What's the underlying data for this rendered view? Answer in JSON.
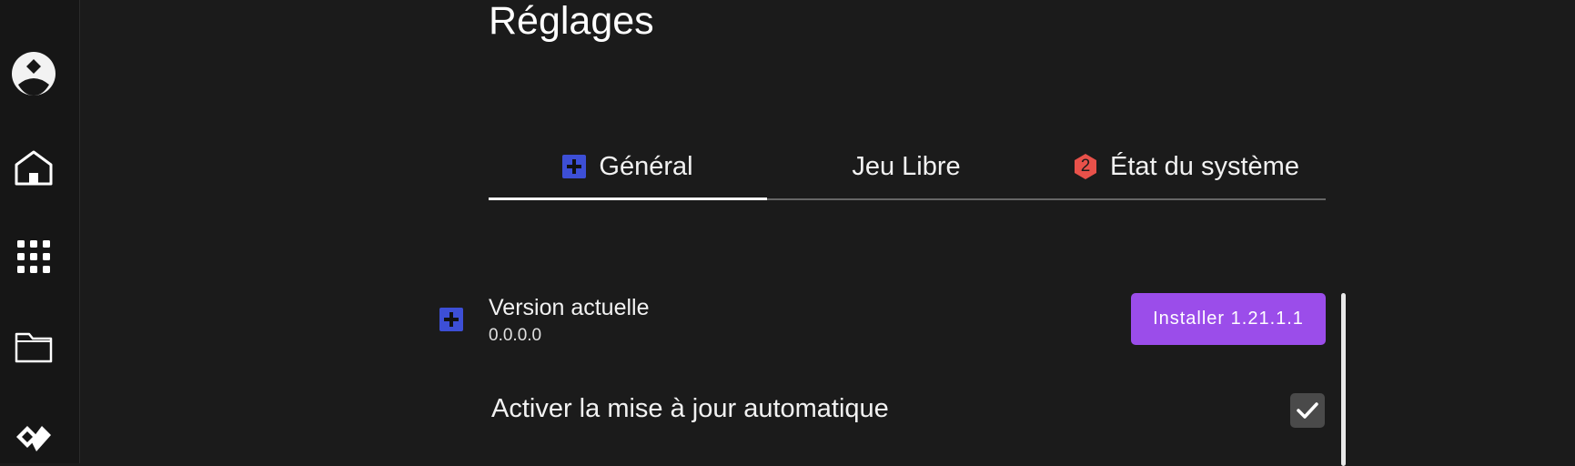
{
  "sidebar": {
    "items": [
      {
        "icon": "avatar-icon"
      },
      {
        "icon": "home-icon"
      },
      {
        "icon": "apps-grid-icon"
      },
      {
        "icon": "folder-icon"
      },
      {
        "icon": "logo-icon"
      }
    ]
  },
  "page": {
    "title": "Réglages"
  },
  "tabs": [
    {
      "label": "Général",
      "icon": "plus-square-icon",
      "active": true
    },
    {
      "label": "Jeu Libre",
      "active": false
    },
    {
      "label": "État du système",
      "badge": "2",
      "active": false
    }
  ],
  "version": {
    "label": "Version actuelle",
    "value": "0.0.0.0",
    "install_button": "Installer 1.21.1.1"
  },
  "auto_update": {
    "label": "Activer la mise à jour automatique",
    "checked": true
  },
  "colors": {
    "background": "#1b1b1b",
    "accent_purple": "#9b4dea",
    "accent_blue": "#3d4fd6",
    "badge_red": "#e8514a"
  }
}
